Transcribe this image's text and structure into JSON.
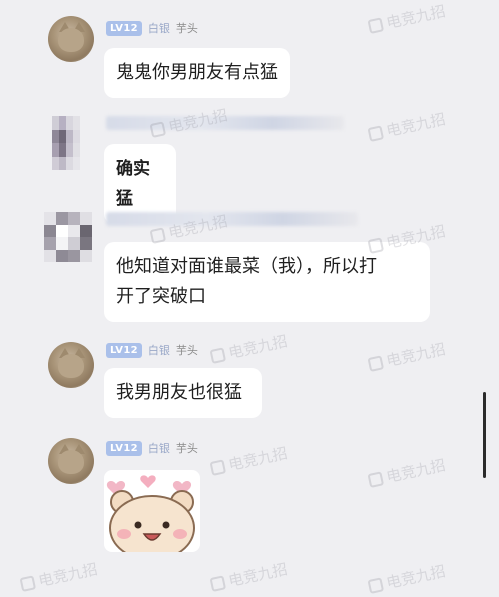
{
  "badges": {
    "level": "LV12",
    "title": "白银"
  },
  "messages": [
    {
      "type": "text",
      "sender": "芋头",
      "text": "鬼鬼你男朋友有点猛"
    },
    {
      "type": "text",
      "sender": "",
      "text": "确实猛"
    },
    {
      "type": "text",
      "sender": "",
      "text_line1": "他知道对面谁最菜（我），所以打",
      "text_line2": "开了突破口"
    },
    {
      "type": "text",
      "sender": "芋头",
      "text": "我男朋友也很猛"
    },
    {
      "type": "sticker",
      "sender": "芋头"
    }
  ],
  "watermark": "电竞九招",
  "colors": {
    "background": "#efeff2",
    "bubble": "#ffffff",
    "level_badge": "#aac0ea",
    "title_badge": "#9aa8c8"
  },
  "icons": [
    "cat-avatar",
    "pixelated-avatar",
    "bear-sticker",
    "scrollbar"
  ]
}
